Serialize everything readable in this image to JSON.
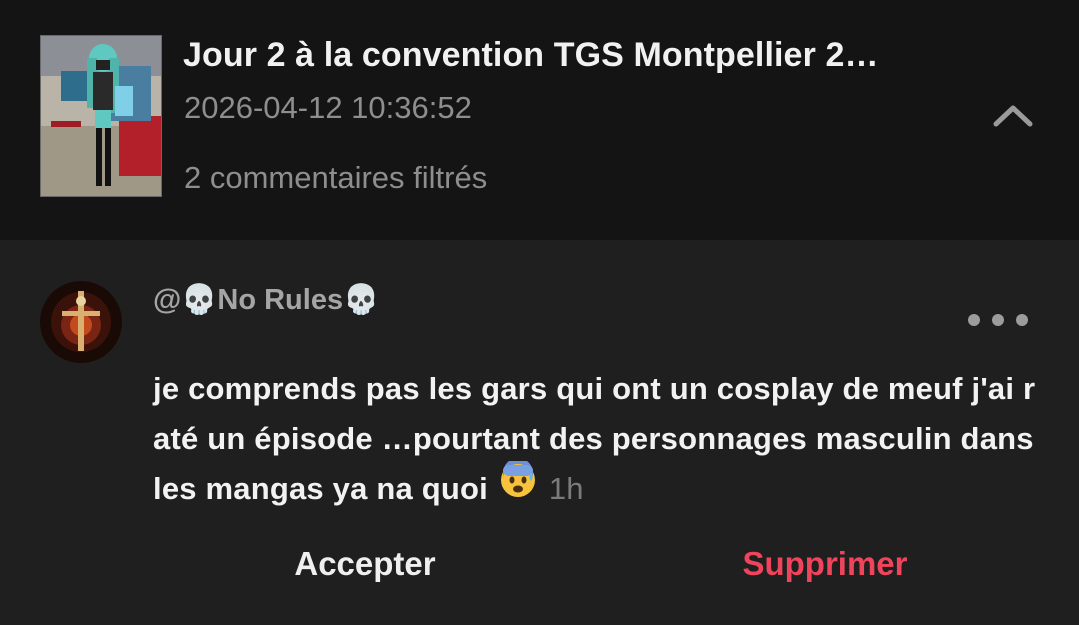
{
  "video": {
    "title": "Jour 2 à la convention TGS Montpellier 2…",
    "date": "2026-04-12 10:36:52",
    "filtered_comments": "2 commentaires filtrés",
    "collapse_icon": "chevron-up-icon"
  },
  "comment": {
    "username": "@💀No Rules💀",
    "text": "je comprends pas les gars qui ont un cosplay de meuf j'ai raté un épisode …pourtant des personnages masculin dans les mangas ya na quoi",
    "emoji": "😰",
    "time": "1h",
    "more_icon": "more-horizontal-icon"
  },
  "actions": {
    "accept_label": "Accepter",
    "delete_label": "Supprimer"
  },
  "colors": {
    "header_bg": "#141414",
    "page_bg": "#1f1f1f",
    "delete_accent": "#f0445c",
    "muted_text": "#8e8e8e"
  }
}
